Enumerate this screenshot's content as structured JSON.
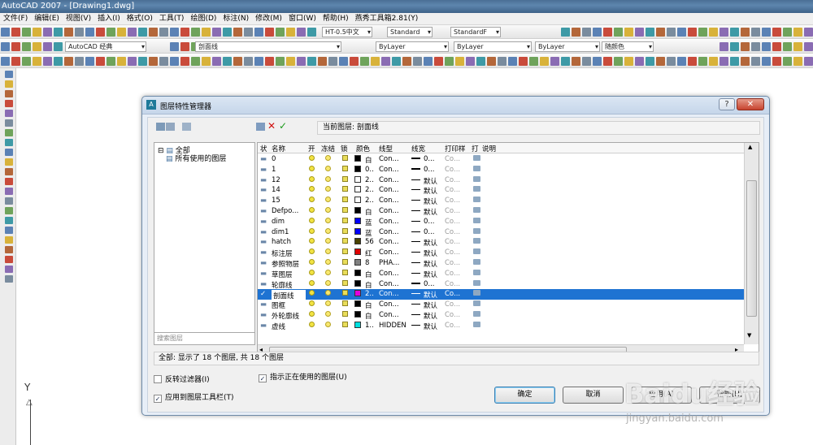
{
  "app": {
    "title": "AutoCAD 2007 - [Drawing1.dwg]"
  },
  "menu": [
    "文件(F)",
    "编辑(E)",
    "视图(V)",
    "插入(I)",
    "格式(O)",
    "工具(T)",
    "绘图(D)",
    "标注(N)",
    "修改(M)",
    "窗口(W)",
    "帮助(H)",
    "燕秀工具箱2.81(Y)"
  ],
  "toolbar": {
    "text_style": "HT-0.5中文",
    "dim_style": "Standard",
    "table_style": "StandardF",
    "workspace": "AutoCAD 经典",
    "layer": "剖面线",
    "color": "ByLayer",
    "linetype": "ByLayer",
    "lineweight": "ByLayer",
    "plotstyle": "随颜色"
  },
  "dialog": {
    "title": "图层特性管理器",
    "current_layer": "当前图层: 剖面线",
    "tree_root": "全部",
    "tree_child": "所有使用的图层",
    "search_placeholder": "搜索图层",
    "columns": [
      "状",
      "名称",
      "开",
      "冻结",
      "锁",
      "颜色",
      "线型",
      "线宽",
      "打印样",
      "打",
      "说明"
    ],
    "layers": [
      {
        "name": "0",
        "color_hex": "#000000",
        "color_label": "白",
        "linetype": "Con...",
        "lineweight": "0...",
        "plot": "Co...",
        "thick": true
      },
      {
        "name": "1",
        "color_hex": "#000000",
        "color_label": "0..",
        "linetype": "Con...",
        "lineweight": "0...",
        "plot": "Co...",
        "thick": true
      },
      {
        "name": "12",
        "color_hex": "#ffffff",
        "color_label": "2..",
        "linetype": "Con...",
        "lineweight": "默认",
        "plot": "Co..."
      },
      {
        "name": "14",
        "color_hex": "#ffffff",
        "color_label": "2..",
        "linetype": "Con...",
        "lineweight": "默认",
        "plot": "Co..."
      },
      {
        "name": "15",
        "color_hex": "#ffffff",
        "color_label": "2..",
        "linetype": "Con...",
        "lineweight": "默认",
        "plot": "Co..."
      },
      {
        "name": "Defpo...",
        "color_hex": "#000000",
        "color_label": "白",
        "linetype": "Con...",
        "lineweight": "默认",
        "plot": "Co..."
      },
      {
        "name": "dim",
        "color_hex": "#0000ff",
        "color_label": "蓝",
        "linetype": "Con...",
        "lineweight": "0...",
        "plot": "Co..."
      },
      {
        "name": "dim1",
        "color_hex": "#0000ff",
        "color_label": "蓝",
        "linetype": "Con...",
        "lineweight": "0...",
        "plot": "Co..."
      },
      {
        "name": "hatch",
        "color_hex": "#4a4200",
        "color_label": "56",
        "linetype": "Con...",
        "lineweight": "默认",
        "plot": "Co..."
      },
      {
        "name": "标注层",
        "color_hex": "#e00000",
        "color_label": "红",
        "linetype": "Con...",
        "lineweight": "默认",
        "plot": "Co..."
      },
      {
        "name": "参照物层",
        "color_hex": "#808080",
        "color_label": "8",
        "linetype": "PHA...",
        "lineweight": "默认",
        "plot": "Co..."
      },
      {
        "name": "草图层",
        "color_hex": "#000000",
        "color_label": "白",
        "linetype": "Con...",
        "lineweight": "默认",
        "plot": "Co..."
      },
      {
        "name": "轮廓线",
        "color_hex": "#000000",
        "color_label": "白",
        "linetype": "Con...",
        "lineweight": "0...",
        "plot": "Co...",
        "thick": true
      },
      {
        "name": "剖面线",
        "color_hex": "#e000e0",
        "color_label": "2..",
        "linetype": "Con...",
        "lineweight": "默认",
        "plot": "Co...",
        "selected": true
      },
      {
        "name": "图框",
        "color_hex": "#000000",
        "color_label": "白",
        "linetype": "Con...",
        "lineweight": "默认",
        "plot": "Co..."
      },
      {
        "name": "外轮廓线",
        "color_hex": "#000000",
        "color_label": "白",
        "linetype": "Con...",
        "lineweight": "默认",
        "plot": "Co..."
      },
      {
        "name": "虚线",
        "color_hex": "#00e0e0",
        "color_label": "1..",
        "linetype": "HIDDEN",
        "lineweight": "默认",
        "plot": "Co..."
      }
    ],
    "status_text": "全部: 显示了 18 个图层, 共 18 个图层",
    "invert_filter": "反转过滤器(I)",
    "indicate_used": "指示正在使用的图层(U)",
    "apply_toolbar": "应用到图层工具栏(T)",
    "ok": "确定",
    "cancel": "取消",
    "apply": "应用(A)",
    "help": "帮助(H)"
  },
  "ucs_y": "Y",
  "watermark": {
    "brand": "Baidu经验",
    "url": "jingyan.baidu.com"
  }
}
